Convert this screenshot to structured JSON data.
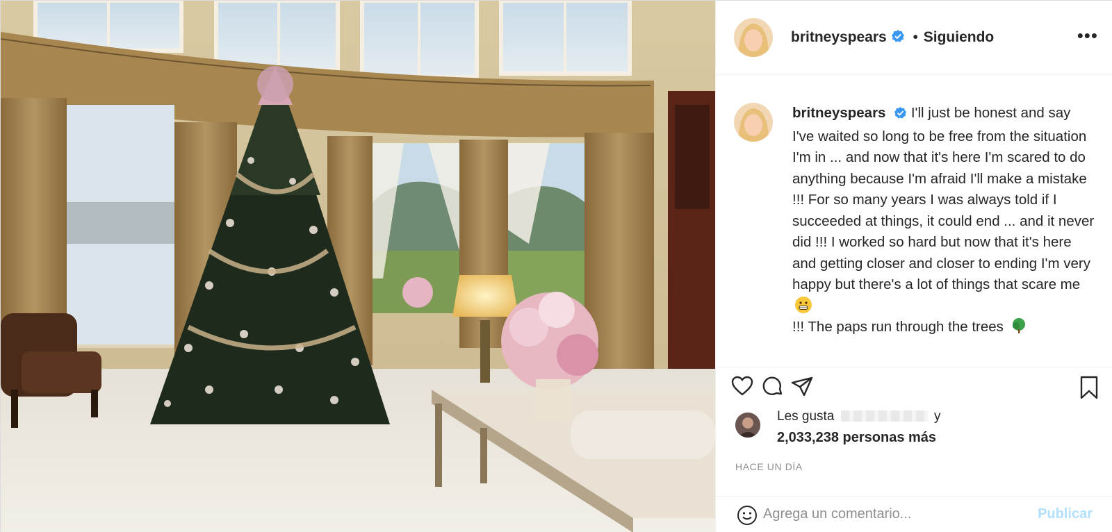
{
  "post": {
    "author": {
      "username": "britneyspears",
      "verified": true,
      "follow_status": "Siguiendo"
    },
    "more_icon": "ellipsis-icon",
    "photo_description_icon": "christmas-tree-living-room-photo",
    "caption": {
      "username": "britneyspears",
      "text": "I'll just be honest and say I've waited so long to be free from the situation I'm in ... and now that it's here I'm scared to do anything because I'm afraid I'll make a mistake !!! For so many years I was always told if I succeeded at things, it could end ... and it never did !!! I worked so hard but now that it's here and getting closer and closer to ending I'm very happy but there's a lot of things that scare me",
      "text_after_emoji": "!!! The paps run through the trees",
      "emojis": [
        "grimacing-face",
        "deciduous-tree"
      ]
    },
    "actions": {
      "icons": [
        "heart-icon",
        "comment-icon",
        "share-icon",
        "bookmark-icon"
      ]
    },
    "likes": {
      "prefix": "Les gusta",
      "suffix": "y",
      "count_line": "2,033,238 personas más"
    },
    "timestamp": "HACE UN DÍA",
    "comment": {
      "placeholder": "Agrega un comentario...",
      "publish_label": "Publicar"
    },
    "colors": {
      "verified": "#3897f0",
      "publish_disabled": "#b2dffc",
      "secondary_text": "#8e8e8e",
      "divider": "#efefef"
    }
  }
}
